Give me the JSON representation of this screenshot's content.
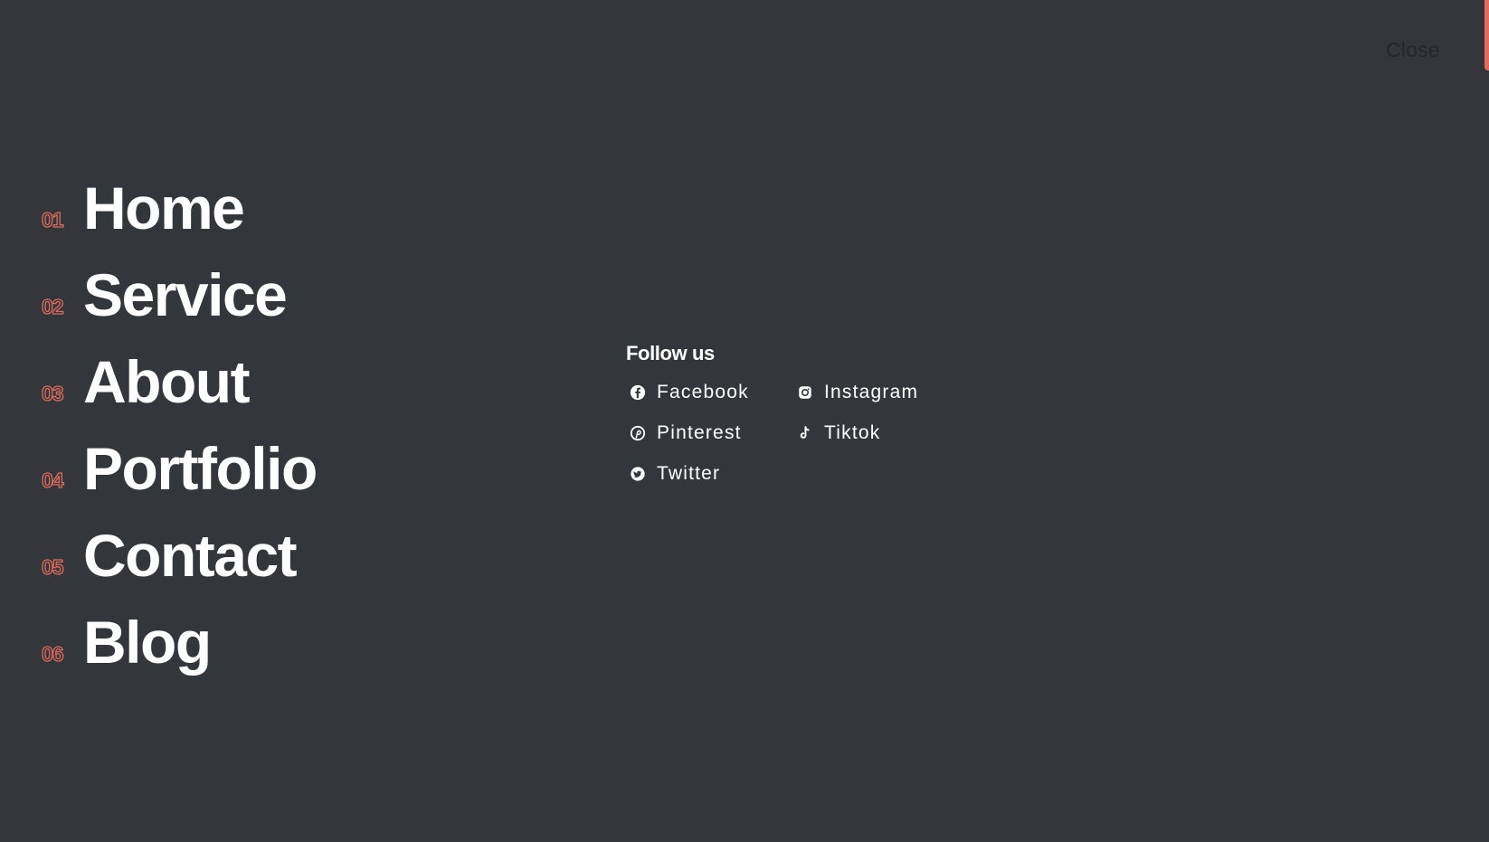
{
  "close_label": "Close",
  "accent_color": "#e06a5c",
  "background_color": "#33373b",
  "menu": [
    {
      "num": "01",
      "label": "Home"
    },
    {
      "num": "02",
      "label": "Service"
    },
    {
      "num": "03",
      "label": "About"
    },
    {
      "num": "04",
      "label": "Portfolio"
    },
    {
      "num": "05",
      "label": "Contact"
    },
    {
      "num": "06",
      "label": "Blog"
    }
  ],
  "follow": {
    "title": "Follow us",
    "links": [
      {
        "label": "Facebook",
        "icon": "facebook-icon"
      },
      {
        "label": "Instagram",
        "icon": "instagram-icon"
      },
      {
        "label": "Pinterest",
        "icon": "pinterest-icon"
      },
      {
        "label": "Tiktok",
        "icon": "tiktok-icon"
      },
      {
        "label": "Twitter",
        "icon": "twitter-icon"
      }
    ]
  }
}
